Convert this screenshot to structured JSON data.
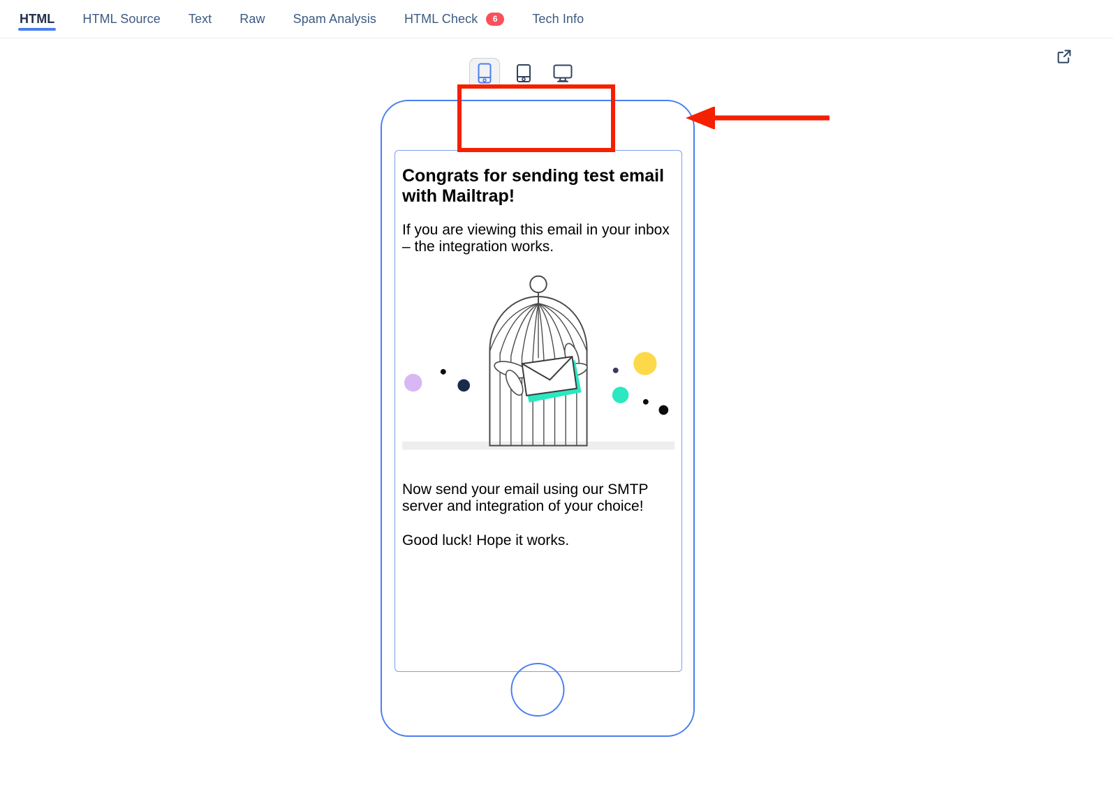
{
  "tabs": [
    {
      "label": "HTML",
      "active": true,
      "badge": null
    },
    {
      "label": "HTML Source",
      "active": false,
      "badge": null
    },
    {
      "label": "Text",
      "active": false,
      "badge": null
    },
    {
      "label": "Raw",
      "active": false,
      "badge": null
    },
    {
      "label": "Spam Analysis",
      "active": false,
      "badge": null
    },
    {
      "label": "HTML Check",
      "active": false,
      "badge": "6"
    },
    {
      "label": "Tech Info",
      "active": false,
      "badge": null
    }
  ],
  "preview": {
    "open_external_icon": "external-link-icon",
    "device_switcher": {
      "options": [
        {
          "name": "mobile",
          "icon": "mobile-phone-icon",
          "selected": true
        },
        {
          "name": "tablet",
          "icon": "tablet-icon",
          "selected": false
        },
        {
          "name": "desktop",
          "icon": "desktop-monitor-icon",
          "selected": false
        }
      ]
    },
    "annotation": {
      "box_color": "#f42000",
      "arrow_color": "#f42000",
      "arrow_direction": "left"
    }
  },
  "email": {
    "heading": "Congrats for sending test email with Mailtrap!",
    "paragraph_1": "If you are viewing this email in your inbox – the integration works.",
    "paragraph_2": "Now send your email using our SMTP server and integration of your choice!",
    "paragraph_3": "Good luck! Hope it works.",
    "illustration": {
      "name": "birdcage-with-winged-envelope",
      "cage_stroke": "#4a4a4a",
      "envelope_accent": "#2ae8c0",
      "dots": [
        {
          "color": "#d7b8f5",
          "size": "large"
        },
        {
          "color": "#000000",
          "size": "tiny"
        },
        {
          "color": "#1b2a4a",
          "size": "small"
        },
        {
          "color": "#3b3b5c",
          "size": "tiny"
        },
        {
          "color": "#fdd949",
          "size": "large"
        },
        {
          "color": "#2ae8c0",
          "size": "medium"
        },
        {
          "color": "#000000",
          "size": "tiny"
        },
        {
          "color": "#000000",
          "size": "small"
        }
      ],
      "floor_color": "#eeeeee"
    }
  },
  "colors": {
    "accent_blue": "#4a7ef0",
    "tab_text": "#3d5a80",
    "tab_active_text": "#22304a",
    "badge_red": "#f9505b",
    "annotation_red": "#f42000"
  }
}
